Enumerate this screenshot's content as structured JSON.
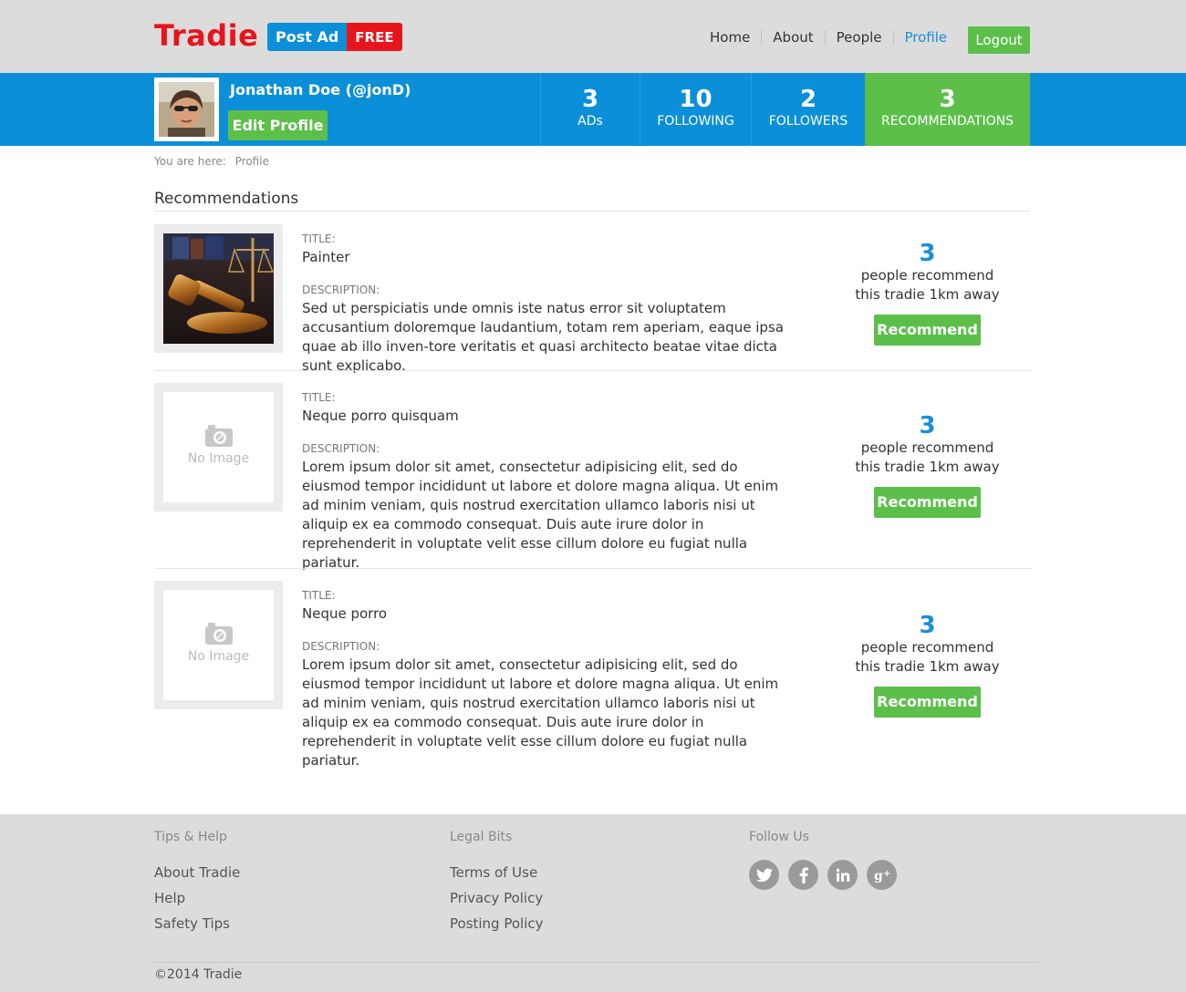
{
  "header": {
    "logo": "Tradie",
    "post_ad": "Post Ad",
    "free": "FREE",
    "nav": [
      {
        "label": "Home"
      },
      {
        "label": "About"
      },
      {
        "label": "People"
      },
      {
        "label": "Profile",
        "active": true
      }
    ],
    "logout": "Logout"
  },
  "profile": {
    "name": "Jonathan Doe (@jonD)",
    "edit_label": "Edit Profile",
    "stats": [
      {
        "num": "3",
        "label": "ADs"
      },
      {
        "num": "10",
        "label": "FOLLOWING"
      },
      {
        "num": "2",
        "label": "FOLLOWERS"
      },
      {
        "num": "3",
        "label": "RECOMMENDATIONS"
      }
    ]
  },
  "breadcrumb": {
    "prefix": "You are here:",
    "current": "Profile"
  },
  "section_title": "Recommendations",
  "labels": {
    "title": "TITLE:",
    "description": "DESCRIPTION:",
    "no_image": "No Image"
  },
  "recommendations": [
    {
      "title": "Painter",
      "description": "Sed ut perspiciatis unde omnis iste natus error sit voluptatem accusantium doloremque laudantium, totam rem aperiam, eaque ipsa quae ab illo inven-tore veritatis et quasi architecto beatae vitae dicta sunt explicabo.",
      "count": "3",
      "people_text": "people recommend",
      "distance_text": "this tradie 1km away",
      "button": "Recommend"
    },
    {
      "title": "Neque porro quisquam",
      "description": "Lorem ipsum dolor sit amet, consectetur adipisicing elit, sed do eiusmod tempor incididunt ut labore et dolore magna aliqua. Ut enim ad minim veniam, quis nostrud exercitation ullamco laboris nisi ut aliquip ex ea commodo consequat. Duis aute irure dolor in reprehenderit in voluptate velit esse cillum dolore eu fugiat nulla pariatur.",
      "count": "3",
      "people_text": "people recommend",
      "distance_text": "this tradie 1km away",
      "button": "Recommend"
    },
    {
      "title": "Neque porro",
      "description": "Lorem ipsum dolor sit amet, consectetur adipisicing elit, sed do eiusmod tempor incididunt ut labore et dolore magna aliqua. Ut enim ad minim veniam, quis nostrud exercitation ullamco laboris nisi ut aliquip ex ea commodo consequat. Duis aute irure dolor in reprehenderit in voluptate velit esse cillum dolore eu fugiat nulla pariatur.",
      "count": "3",
      "people_text": "people recommend",
      "distance_text": "this tradie 1km away",
      "button": "Recommend"
    }
  ],
  "footer": {
    "tips": {
      "heading": "Tips & Help",
      "links": [
        "About Tradie",
        "Help",
        "Safety Tips"
      ]
    },
    "legal": {
      "heading": "Legal Bits",
      "links": [
        "Terms of Use",
        "Privacy Policy",
        "Posting Policy"
      ]
    },
    "follow": {
      "heading": "Follow Us",
      "icons": [
        "twitter-icon",
        "facebook-icon",
        "linkedin-icon",
        "google-plus-icon"
      ]
    },
    "copyright": "©2014 Tradie"
  },
  "colors": {
    "brand_red": "#e8141c",
    "brand_blue": "#0b8fd8",
    "accent_green": "#5bbf4a"
  }
}
